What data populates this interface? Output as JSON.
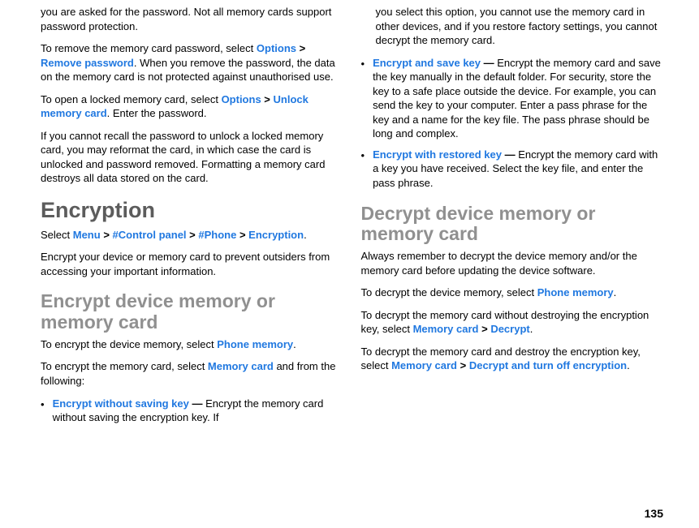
{
  "left": {
    "p1": "you are asked for the password. Not all memory cards support password protection.",
    "p2_a": "To remove the memory card password, select ",
    "p2_link1": "Options",
    "p2_gt1": " > ",
    "p2_link2": "Remove password",
    "p2_b": ". When you remove the password, the data on the memory card is not protected against unauthorised use.",
    "p3_a": "To open a locked memory card, select ",
    "p3_link1": "Options",
    "p3_gt": " > ",
    "p3_link2": "Unlock memory card",
    "p3_b": ". Enter the password.",
    "p4": "If you cannot recall the password to unlock a locked memory card, you may reformat the card, in which case the card is unlocked and password removed. Formatting a memory card destroys all data stored on the card.",
    "h1": "Encryption",
    "p5_a": "Select ",
    "p5_link1": "Menu",
    "p5_gt1": " > ",
    "p5_link2": "#Control panel",
    "p5_gt2": " > ",
    "p5_link3": "#Phone",
    "p5_gt3": " > ",
    "p5_link4": "Encryption",
    "p5_b": ".",
    "p6": "Encrypt your device or memory card to prevent outsiders from accessing your important information.",
    "h2": "Encrypt device memory or memory card",
    "p7_a": "To encrypt the device memory, select ",
    "p7_link": "Phone memory",
    "p7_b": ".",
    "p8_a": "To encrypt the memory card, select ",
    "p8_link": "Memory card",
    "p8_b": " and from the following:",
    "b1_label": "Encrypt without saving key",
    "b1_dash": " — ",
    "b1_text": "Encrypt the memory card without saving the encryption key. If"
  },
  "right": {
    "b1_cont": "you select this option, you cannot use the memory card in other devices, and if you restore factory settings, you cannot decrypt the memory card.",
    "b2_label": "Encrypt and save key",
    "b2_dash": " — ",
    "b2_text": "Encrypt the memory card and save the key manually in the default folder. For security, store the key to a safe place outside the device. For example, you can send the key to your computer. Enter a pass phrase for the key and a name for the key file. The pass phrase should be long and complex.",
    "b3_label": "Encrypt with restored key",
    "b3_dash": " — ",
    "b3_text": "Encrypt the memory card with a key you have received. Select the key file, and enter the pass phrase.",
    "h2": "Decrypt device memory or memory card",
    "p1": "Always remember to decrypt the device memory and/or the memory card before updating the device software.",
    "p2_a": "To decrypt the device memory, select ",
    "p2_link": "Phone memory",
    "p2_b": ".",
    "p3_a": "To decrypt the memory card without destroying the encryption key, select ",
    "p3_link1": "Memory card",
    "p3_gt": " > ",
    "p3_link2": "Decrypt",
    "p3_b": ".",
    "p4_a": "To decrypt the memory card and destroy the encryption key, select ",
    "p4_link1": "Memory card",
    "p4_gt": " > ",
    "p4_link2": "Decrypt and turn off encryption",
    "p4_b": "."
  },
  "bullet_char": "•",
  "page_number": "135"
}
